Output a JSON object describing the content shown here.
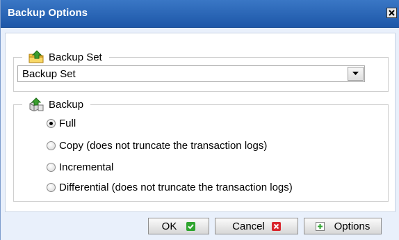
{
  "dialog": {
    "title": "Backup Options",
    "close_icon": "close-icon"
  },
  "backup_set_group": {
    "legend": "Backup Set",
    "icon": "backup-set-icon",
    "selected_value": "Backup Set",
    "dropdown_icon": "chevron-down-icon"
  },
  "backup_group": {
    "legend": "Backup",
    "icon": "backup-icon",
    "options": [
      {
        "label": "Full",
        "checked": true
      },
      {
        "label": "Copy (does not truncate the transaction logs)",
        "checked": false
      },
      {
        "label": "Incremental",
        "checked": false
      },
      {
        "label": "Differential (does not truncate the transaction logs)",
        "checked": false
      }
    ]
  },
  "buttons": {
    "ok": {
      "label": "OK",
      "icon": "check-icon",
      "color": "#2fa52f"
    },
    "cancel": {
      "label": "Cancel",
      "icon": "x-icon",
      "color": "#d9252c"
    },
    "options": {
      "label": "Options",
      "icon": "plus-icon",
      "color": "#2fa52f"
    }
  }
}
